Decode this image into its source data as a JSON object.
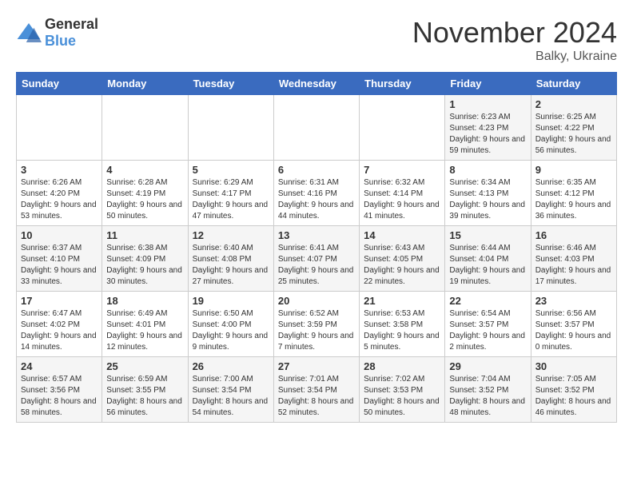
{
  "logo": {
    "general": "General",
    "blue": "Blue"
  },
  "title": "November 2024",
  "location": "Balky, Ukraine",
  "days_of_week": [
    "Sunday",
    "Monday",
    "Tuesday",
    "Wednesday",
    "Thursday",
    "Friday",
    "Saturday"
  ],
  "weeks": [
    [
      {
        "num": "",
        "info": ""
      },
      {
        "num": "",
        "info": ""
      },
      {
        "num": "",
        "info": ""
      },
      {
        "num": "",
        "info": ""
      },
      {
        "num": "",
        "info": ""
      },
      {
        "num": "1",
        "info": "Sunrise: 6:23 AM\nSunset: 4:23 PM\nDaylight: 9 hours and 59 minutes."
      },
      {
        "num": "2",
        "info": "Sunrise: 6:25 AM\nSunset: 4:22 PM\nDaylight: 9 hours and 56 minutes."
      }
    ],
    [
      {
        "num": "3",
        "info": "Sunrise: 6:26 AM\nSunset: 4:20 PM\nDaylight: 9 hours and 53 minutes."
      },
      {
        "num": "4",
        "info": "Sunrise: 6:28 AM\nSunset: 4:19 PM\nDaylight: 9 hours and 50 minutes."
      },
      {
        "num": "5",
        "info": "Sunrise: 6:29 AM\nSunset: 4:17 PM\nDaylight: 9 hours and 47 minutes."
      },
      {
        "num": "6",
        "info": "Sunrise: 6:31 AM\nSunset: 4:16 PM\nDaylight: 9 hours and 44 minutes."
      },
      {
        "num": "7",
        "info": "Sunrise: 6:32 AM\nSunset: 4:14 PM\nDaylight: 9 hours and 41 minutes."
      },
      {
        "num": "8",
        "info": "Sunrise: 6:34 AM\nSunset: 4:13 PM\nDaylight: 9 hours and 39 minutes."
      },
      {
        "num": "9",
        "info": "Sunrise: 6:35 AM\nSunset: 4:12 PM\nDaylight: 9 hours and 36 minutes."
      }
    ],
    [
      {
        "num": "10",
        "info": "Sunrise: 6:37 AM\nSunset: 4:10 PM\nDaylight: 9 hours and 33 minutes."
      },
      {
        "num": "11",
        "info": "Sunrise: 6:38 AM\nSunset: 4:09 PM\nDaylight: 9 hours and 30 minutes."
      },
      {
        "num": "12",
        "info": "Sunrise: 6:40 AM\nSunset: 4:08 PM\nDaylight: 9 hours and 27 minutes."
      },
      {
        "num": "13",
        "info": "Sunrise: 6:41 AM\nSunset: 4:07 PM\nDaylight: 9 hours and 25 minutes."
      },
      {
        "num": "14",
        "info": "Sunrise: 6:43 AM\nSunset: 4:05 PM\nDaylight: 9 hours and 22 minutes."
      },
      {
        "num": "15",
        "info": "Sunrise: 6:44 AM\nSunset: 4:04 PM\nDaylight: 9 hours and 19 minutes."
      },
      {
        "num": "16",
        "info": "Sunrise: 6:46 AM\nSunset: 4:03 PM\nDaylight: 9 hours and 17 minutes."
      }
    ],
    [
      {
        "num": "17",
        "info": "Sunrise: 6:47 AM\nSunset: 4:02 PM\nDaylight: 9 hours and 14 minutes."
      },
      {
        "num": "18",
        "info": "Sunrise: 6:49 AM\nSunset: 4:01 PM\nDaylight: 9 hours and 12 minutes."
      },
      {
        "num": "19",
        "info": "Sunrise: 6:50 AM\nSunset: 4:00 PM\nDaylight: 9 hours and 9 minutes."
      },
      {
        "num": "20",
        "info": "Sunrise: 6:52 AM\nSunset: 3:59 PM\nDaylight: 9 hours and 7 minutes."
      },
      {
        "num": "21",
        "info": "Sunrise: 6:53 AM\nSunset: 3:58 PM\nDaylight: 9 hours and 5 minutes."
      },
      {
        "num": "22",
        "info": "Sunrise: 6:54 AM\nSunset: 3:57 PM\nDaylight: 9 hours and 2 minutes."
      },
      {
        "num": "23",
        "info": "Sunrise: 6:56 AM\nSunset: 3:57 PM\nDaylight: 9 hours and 0 minutes."
      }
    ],
    [
      {
        "num": "24",
        "info": "Sunrise: 6:57 AM\nSunset: 3:56 PM\nDaylight: 8 hours and 58 minutes."
      },
      {
        "num": "25",
        "info": "Sunrise: 6:59 AM\nSunset: 3:55 PM\nDaylight: 8 hours and 56 minutes."
      },
      {
        "num": "26",
        "info": "Sunrise: 7:00 AM\nSunset: 3:54 PM\nDaylight: 8 hours and 54 minutes."
      },
      {
        "num": "27",
        "info": "Sunrise: 7:01 AM\nSunset: 3:54 PM\nDaylight: 8 hours and 52 minutes."
      },
      {
        "num": "28",
        "info": "Sunrise: 7:02 AM\nSunset: 3:53 PM\nDaylight: 8 hours and 50 minutes."
      },
      {
        "num": "29",
        "info": "Sunrise: 7:04 AM\nSunset: 3:52 PM\nDaylight: 8 hours and 48 minutes."
      },
      {
        "num": "30",
        "info": "Sunrise: 7:05 AM\nSunset: 3:52 PM\nDaylight: 8 hours and 46 minutes."
      }
    ]
  ]
}
